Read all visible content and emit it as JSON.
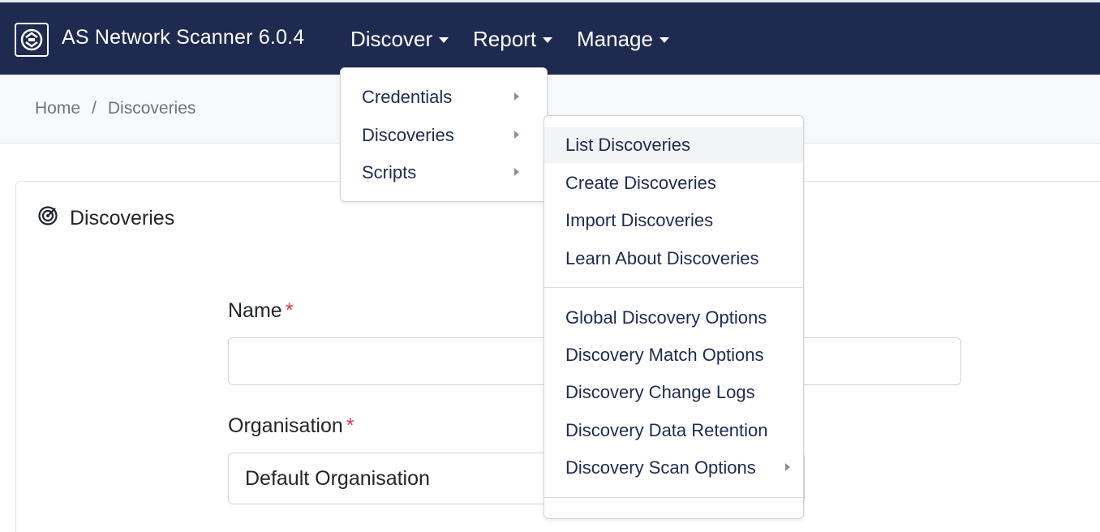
{
  "app": {
    "title": "AS Network Scanner 6.0.4"
  },
  "nav": {
    "discover": "Discover",
    "report": "Report",
    "manage": "Manage"
  },
  "breadcrumb": {
    "home": "Home",
    "separator": "/",
    "current": "Discoveries"
  },
  "card": {
    "title": "Discoveries"
  },
  "form": {
    "name_label": "Name",
    "required_mark": "*",
    "name_value": "",
    "organisation_label": "Organisation",
    "organisation_value": "Default Organisation"
  },
  "discover_menu": {
    "items": [
      {
        "label": "Credentials"
      },
      {
        "label": "Discoveries"
      },
      {
        "label": "Scripts"
      }
    ]
  },
  "discoveries_submenu": {
    "items": [
      {
        "label": "List Discoveries"
      },
      {
        "label": "Create Discoveries"
      },
      {
        "label": "Import Discoveries"
      },
      {
        "label": "Learn About Discoveries"
      },
      {
        "label": "Global Discovery Options"
      },
      {
        "label": "Discovery Match Options"
      },
      {
        "label": "Discovery Change Logs"
      },
      {
        "label": "Discovery Data Retention"
      },
      {
        "label": "Discovery Scan Options"
      }
    ]
  },
  "colors": {
    "navbar": "#1e2a4f",
    "menu_text": "#1e2a4f",
    "required": "#dc3545"
  }
}
